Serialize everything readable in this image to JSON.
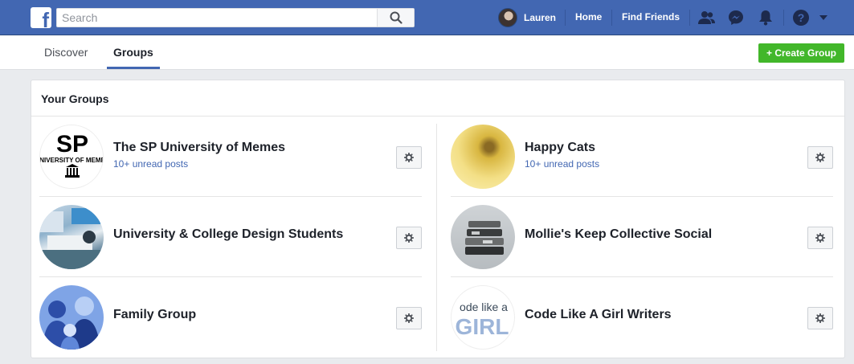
{
  "header": {
    "logo_letter": "f",
    "search_placeholder": "Search",
    "user_name": "Lauren",
    "home_label": "Home",
    "find_friends_label": "Find Friends"
  },
  "subnav": {
    "tabs": [
      {
        "label": "Discover",
        "active": false
      },
      {
        "label": "Groups",
        "active": true
      }
    ],
    "create_group_label": "+ Create Group"
  },
  "card": {
    "title": "Your Groups",
    "groups": [
      {
        "name": "The SP University of Memes",
        "subtitle": "10+ unread posts",
        "avatar": "sp-memes-logo"
      },
      {
        "name": "Happy Cats",
        "subtitle": "10+ unread posts",
        "avatar": "cat-photo"
      },
      {
        "name": "University & College Design Students",
        "subtitle": "",
        "avatar": "design-photo"
      },
      {
        "name": "Mollie's Keep Collective Social",
        "subtitle": "",
        "avatar": "bracelets-photo"
      },
      {
        "name": "Family Group",
        "subtitle": "",
        "avatar": "family-illustration"
      },
      {
        "name": "Code Like A Girl Writers",
        "subtitle": "",
        "avatar": "code-like-a-girl-logo"
      }
    ]
  },
  "logos": {
    "sp_text": "SP",
    "sp_subtext": "NIVERSITY OF MEME",
    "code_line1": "ode like a",
    "code_line2": "GIRL"
  },
  "colors": {
    "brand_blue": "#4267b2",
    "create_green": "#42b72a",
    "page_bg": "#e9ebee"
  },
  "icons": [
    "search-icon",
    "friends-icon",
    "messenger-icon",
    "notifications-icon",
    "help-icon",
    "dropdown-icon",
    "gear-icon"
  ]
}
